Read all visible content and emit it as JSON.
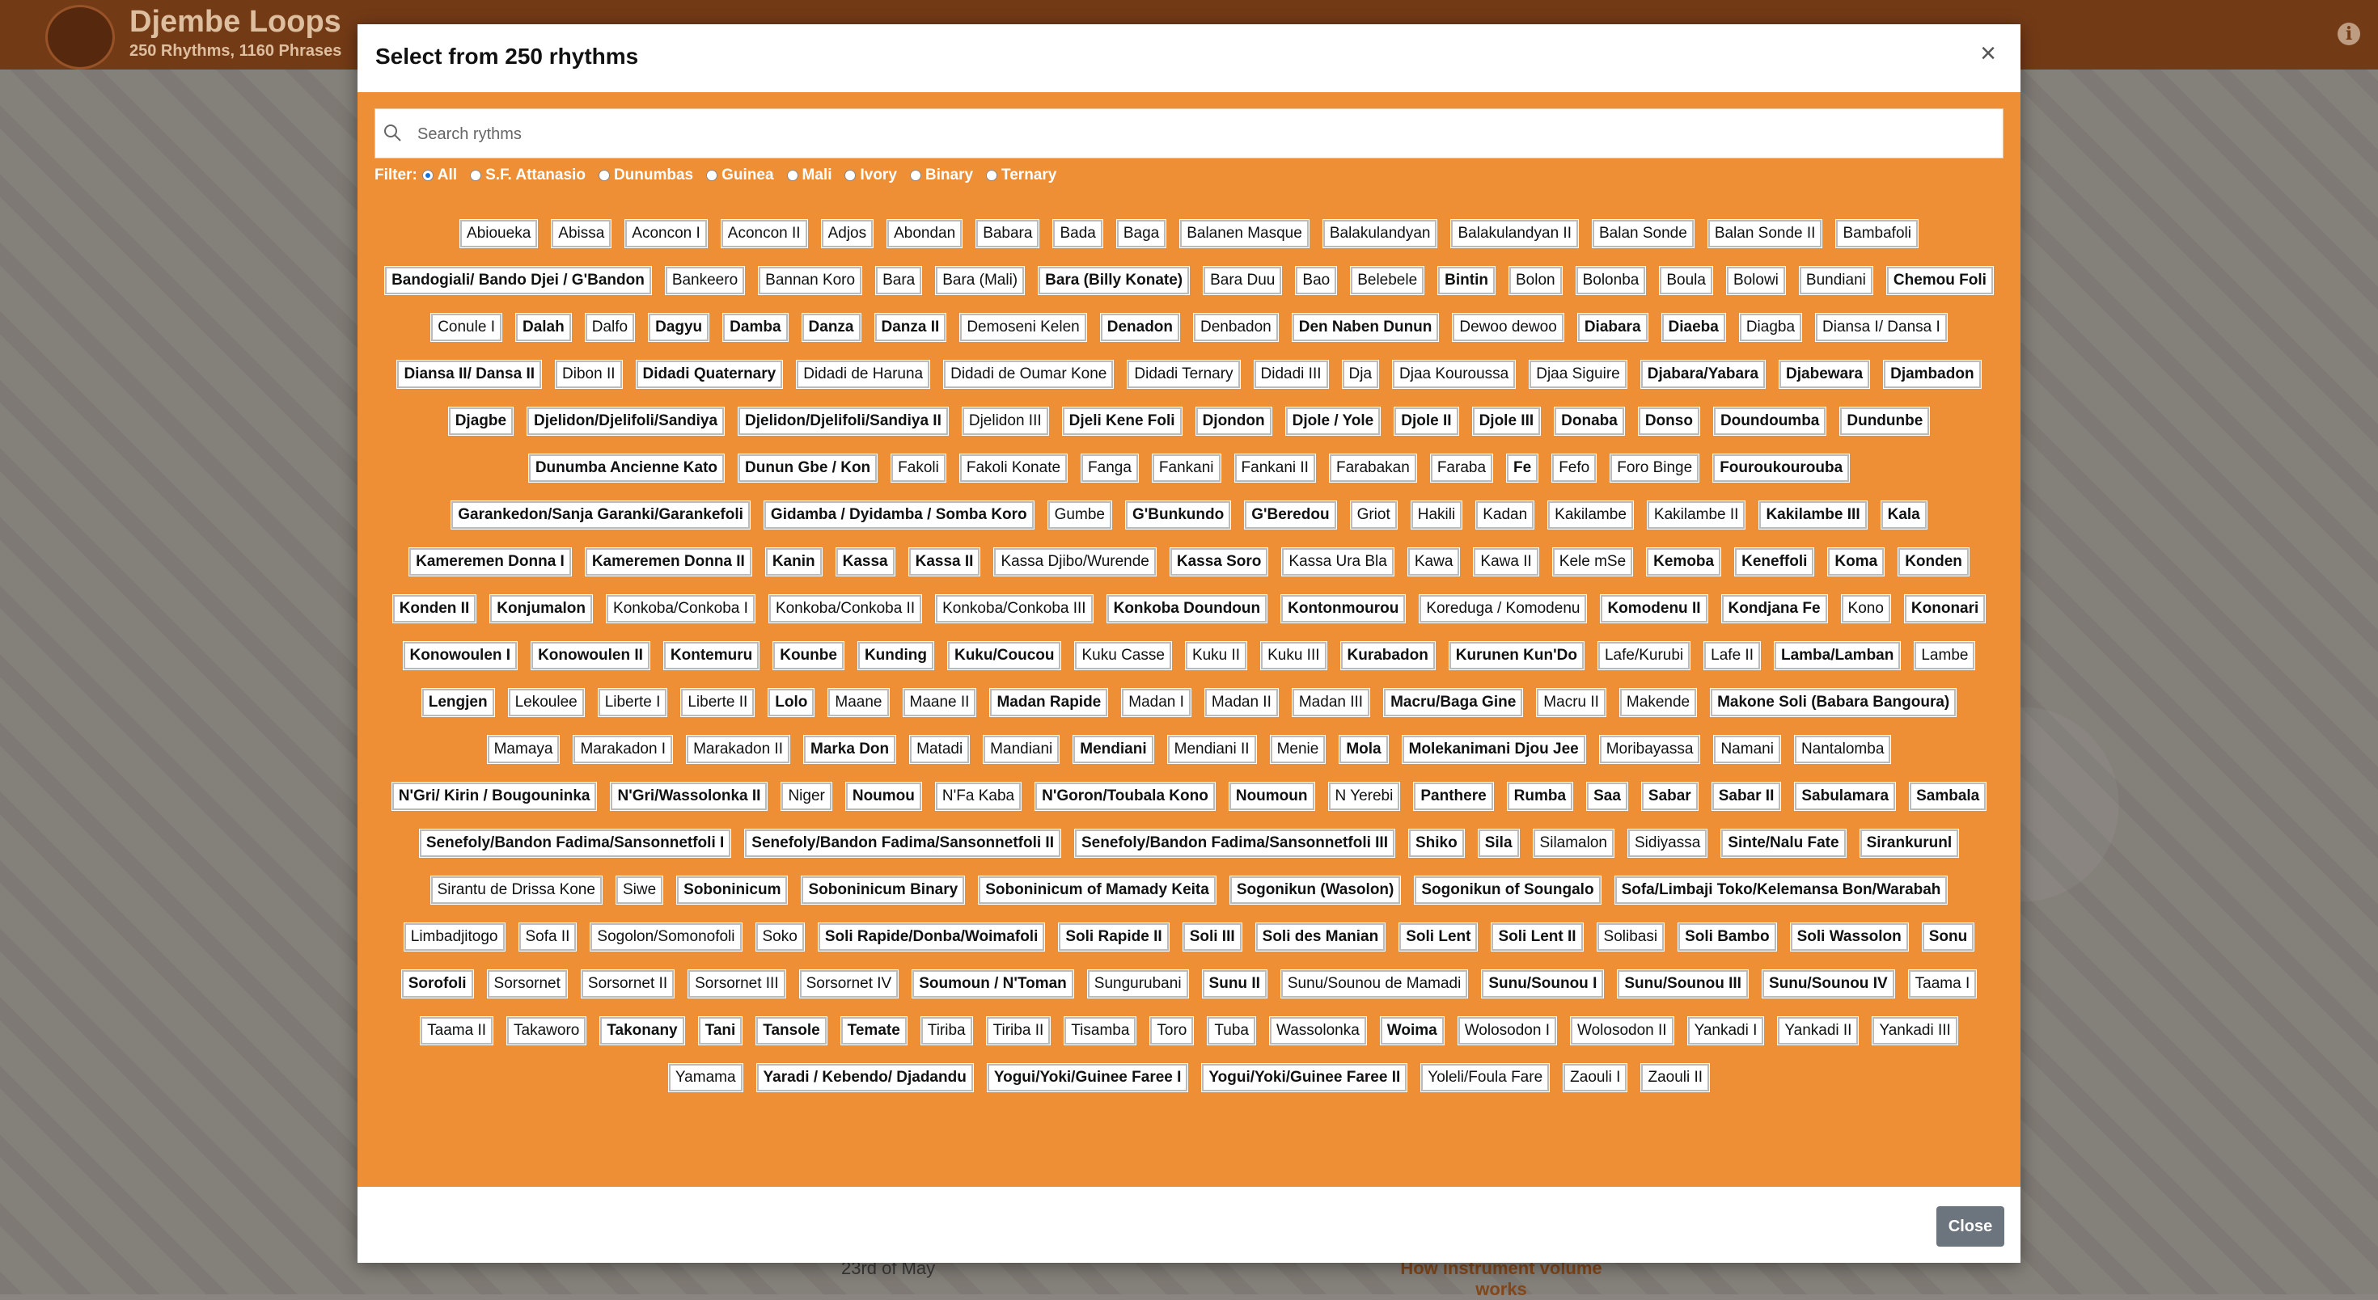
{
  "app": {
    "title": "Djembe Loops",
    "subtitle": "250 Rhythms, 1160 Phrases",
    "info_icon": "info-icon"
  },
  "background": {
    "date_text": "23rd of May",
    "link_text": "How instrument volume works"
  },
  "modal": {
    "title": "Select from 250 rhythms",
    "close_icon": "×",
    "search_placeholder": "Search rythms",
    "filter_label": "Filter:",
    "filters": [
      {
        "label": "All",
        "checked": true
      },
      {
        "label": "S.F. Attanasio",
        "checked": false
      },
      {
        "label": "Dunumbas",
        "checked": false
      },
      {
        "label": "Guinea",
        "checked": false
      },
      {
        "label": "Mali",
        "checked": false
      },
      {
        "label": "Ivory",
        "checked": false
      },
      {
        "label": "Binary",
        "checked": false
      },
      {
        "label": "Ternary",
        "checked": false
      }
    ],
    "close_button": "Close",
    "rhythms": [
      "Abioueka",
      "Abissa",
      "Aconcon I",
      "Aconcon II",
      "Adjos",
      "Abondan",
      "Babara",
      "Bada",
      "Baga",
      "Balanen Masque",
      "Balakulandyan",
      "Balakulandyan II",
      "Balan Sonde",
      "Balan Sonde II",
      "Bambafoli",
      "Bandogiali/ Bando Djei / G'Bandon",
      "Bankeero",
      "Bannan Koro",
      "Bara",
      "Bara (Mali)",
      "Bara (Billy Konate)",
      "Bara Duu",
      "Bao",
      "Belebele",
      "Bintin",
      "Bolon",
      "Bolonba",
      "Boula",
      "Bolowi",
      "Bundiani",
      "Chemou Foli",
      "Conule I",
      "Dalah",
      "Dalfo",
      "Dagyu",
      "Damba",
      "Danza",
      "Danza II",
      "Demoseni Kelen",
      "Denadon",
      "Denbadon",
      "Den Naben Dunun",
      "Dewoo dewoo",
      "Diabara",
      "Diaeba",
      "Diagba",
      "Diansa I/ Dansa I",
      "Diansa II/ Dansa II",
      "Dibon II",
      "Didadi Quaternary",
      "Didadi de Haruna",
      "Didadi de Oumar Kone",
      "Didadi Ternary",
      "Didadi III",
      "Dja",
      "Djaa Kouroussa",
      "Djaa Siguire",
      "Djabara/Yabara",
      "Djabewara",
      "Djambadon",
      "Djagbe",
      "Djelidon/Djelifoli/Sandiya",
      "Djelidon/Djelifoli/Sandiya II",
      "Djelidon III",
      "Djeli Kene Foli",
      "Djondon",
      "Djole / Yole",
      "Djole II",
      "Djole III",
      "Donaba",
      "Donso",
      "Doundoumba",
      "Dundunbe",
      "Dunumba Ancienne Kato",
      "Dunun Gbe / Kon",
      "Fakoli",
      "Fakoli Konate",
      "Fanga",
      "Fankani",
      "Fankani II",
      "Farabakan",
      "Faraba",
      "Fe",
      "Fefo",
      "Foro Binge",
      "Fouroukourouba",
      "Garankedon/Sanja Garanki/Garankefoli",
      "Gidamba / Dyidamba / Somba Koro",
      "Gumbe",
      "G'Bunkundo",
      "G'Beredou",
      "Griot",
      "Hakili",
      "Kadan",
      "Kakilambe",
      "Kakilambe II",
      "Kakilambe III",
      "Kala",
      "Kameremen Donna I",
      "Kameremen Donna II",
      "Kanin",
      "Kassa",
      "Kassa II",
      "Kassa Djibo/Wurende",
      "Kassa Soro",
      "Kassa Ura Bla",
      "Kawa",
      "Kawa II",
      "Kele mSe",
      "Kemoba",
      "Keneffoli",
      "Koma",
      "Konden",
      "Konden II",
      "Konjumalon",
      "Konkoba/Conkoba I",
      "Konkoba/Conkoba II",
      "Konkoba/Conkoba III",
      "Konkoba Doundoun",
      "Kontonmourou",
      "Koreduga / Komodenu",
      "Komodenu II",
      "Kondjana Fe",
      "Kono",
      "Kononari",
      "Konowoulen I",
      "Konowoulen II",
      "Kontemuru",
      "Kounbe",
      "Kunding",
      "Kuku/Coucou",
      "Kuku Casse",
      "Kuku II",
      "Kuku III",
      "Kurabadon",
      "Kurunen Kun'Do",
      "Lafe/Kurubi",
      "Lafe II",
      "Lamba/Lamban",
      "Lambe",
      "Lengjen",
      "Lekoulee",
      "Liberte I",
      "Liberte II",
      "Lolo",
      "Maane",
      "Maane II",
      "Madan Rapide",
      "Madan I",
      "Madan II",
      "Madan III",
      "Macru/Baga Gine",
      "Macru II",
      "Makende",
      "Makone Soli (Babara Bangoura)",
      "Mamaya",
      "Marakadon I",
      "Marakadon II",
      "Marka Don",
      "Matadi",
      "Mandiani",
      "Mendiani",
      "Mendiani II",
      "Menie",
      "Mola",
      "Molekanimani Djou Jee",
      "Moribayassa",
      "Namani",
      "Nantalomba",
      "N'Gri/ Kirin / Bougouninka",
      "N'Gri/Wassolonka II",
      "Niger",
      "Noumou",
      "N'Fa Kaba",
      "N'Goron/Toubala Kono",
      "Noumoun",
      "N Yerebi",
      "Panthere",
      "Rumba",
      "Saa",
      "Sabar",
      "Sabar II",
      "Sabulamara",
      "Sambala",
      "Senefoly/Bandon Fadima/Sansonnetfoli I",
      "Senefoly/Bandon Fadima/Sansonnetfoli II",
      "Senefoly/Bandon Fadima/Sansonnetfoli III",
      "Shiko",
      "Sila",
      "Silamalon",
      "Sidiyassa",
      "Sinte/Nalu Fate",
      "Sirankurunl",
      "Sirantu de Drissa Kone",
      "Siwe",
      "Soboninicum",
      "Soboninicum Binary",
      "Soboninicum of Mamady Keita",
      "Sogonikun (Wasolon)",
      "Sogonikun of Soungalo",
      "Sofa/Limbaji Toko/Kelemansa Bon/Warabah",
      "Limbadjitogo",
      "Sofa II",
      "Sogolon/Somonofoli",
      "Soko",
      "Soli Rapide/Donba/Woimafoli",
      "Soli Rapide II",
      "Soli III",
      "Soli des Manian",
      "Soli Lent",
      "Soli Lent II",
      "Solibasi",
      "Soli Bambo",
      "Soli Wassolon",
      "Sonu",
      "Sorofoli",
      "Sorsornet",
      "Sorsornet II",
      "Sorsornet III",
      "Sorsornet IV",
      "Soumoun / N'Toman",
      "Sungurubani",
      "Sunu II",
      "Sunu/Sounou de Mamadi",
      "Sunu/Sounou I",
      "Sunu/Sounou III",
      "Sunu/Sounou IV",
      "Taama I",
      "Taama II",
      "Takaworo",
      "Takonany",
      "Tani",
      "Tansole",
      "Temate",
      "Tiriba",
      "Tiriba II",
      "Tisamba",
      "Toro",
      "Tuba",
      "Wassolonka",
      "Woima",
      "Wolosodon I",
      "Wolosodon II",
      "Yankadi I",
      "Yankadi II",
      "Yankadi III",
      "Yamama",
      "Yaradi / Kebendo/ Djadandu",
      "Yogui/Yoki/Guinee Faree I",
      "Yogui/Yoki/Guinee Faree II",
      "Yoleli/Foula Fare",
      "Zaouli I",
      "Zaouli II"
    ],
    "bold_rhythms": [
      "Bandogiali/ Bando Djei / G'Bandon",
      "Bara (Billy Konate)",
      "Bintin",
      "Chemou Foli",
      "Dalah",
      "Dagyu",
      "Damba",
      "Danza",
      "Danza II",
      "Denadon",
      "Den Naben Dunun",
      "Diabara",
      "Diaeba",
      "Diansa II/ Dansa II",
      "Didadi Quaternary",
      "Djabara/Yabara",
      "Djabewara",
      "Djambadon",
      "Djagbe",
      "Djelidon/Djelifoli/Sandiya",
      "Djelidon/Djelifoli/Sandiya II",
      "Djeli Kene Foli",
      "Djondon",
      "Djole / Yole",
      "Djole II",
      "Djole III",
      "Donaba",
      "Donso",
      "Doundoumba",
      "Dundunbe",
      "Dunumba Ancienne Kato",
      "Dunun Gbe / Kon",
      "Fe",
      "Fouroukourouba",
      "Garankedon/Sanja Garanki/Garankefoli",
      "Gidamba / Dyidamba / Somba Koro",
      "G'Bunkundo",
      "G'Beredou",
      "Kakilambe III",
      "Kala",
      "Kameremen Donna I",
      "Kameremen Donna II",
      "Kanin",
      "Kassa",
      "Kassa II",
      "Kassa Soro",
      "Kemoba",
      "Keneffoli",
      "Koma",
      "Konden",
      "Konden II",
      "Konjumalon",
      "Konkoba Doundoun",
      "Kontonmourou",
      "Komodenu II",
      "Kondjana Fe",
      "Kononari",
      "Konowoulen I",
      "Konowoulen II",
      "Kontemuru",
      "Kounbe",
      "Kunding",
      "Kuku/Coucou",
      "Kurabadon",
      "Kurunen Kun'Do",
      "Lamba/Lamban",
      "Lengjen",
      "Lolo",
      "Madan Rapide",
      "Macru/Baga Gine",
      "Makone Soli (Babara Bangoura)",
      "Marka Don",
      "Mendiani",
      "Mola",
      "Molekanimani Djou Jee",
      "N'Gri/ Kirin / Bougouninka",
      "N'Gri/Wassolonka II",
      "Noumou",
      "N'Goron/Toubala Kono",
      "Noumoun",
      "Panthere",
      "Rumba",
      "Saa",
      "Sabar",
      "Sabar II",
      "Sabulamara",
      "Sambala",
      "Senefoly/Bandon Fadima/Sansonnetfoli I",
      "Senefoly/Bandon Fadima/Sansonnetfoli II",
      "Senefoly/Bandon Fadima/Sansonnetfoli III",
      "Shiko",
      "Sila",
      "Sinte/Nalu Fate",
      "Sirankurunl",
      "Soboninicum",
      "Soboninicum Binary",
      "Soboninicum of Mamady Keita",
      "Sogonikun (Wasolon)",
      "Sogonikun of Soungalo",
      "Sofa/Limbaji Toko/Kelemansa Bon/Warabah",
      "Soli Rapide/Donba/Woimafoli",
      "Soli Rapide II",
      "Soli III",
      "Soli des Manian",
      "Soli Lent",
      "Soli Lent II",
      "Soli Bambo",
      "Soli Wassolon",
      "Sonu",
      "Sorofoli",
      "Soumoun / N'Toman",
      "Sunu II",
      "Sunu/Sounou I",
      "Sunu/Sounou III",
      "Sunu/Sounou IV",
      "Takonany",
      "Tani",
      "Tansole",
      "Temate",
      "Woima",
      "Yaradi / Kebendo/ Djadandu",
      "Yogui/Yoki/Guinee Faree I",
      "Yogui/Yoki/Guinee Faree II"
    ]
  }
}
